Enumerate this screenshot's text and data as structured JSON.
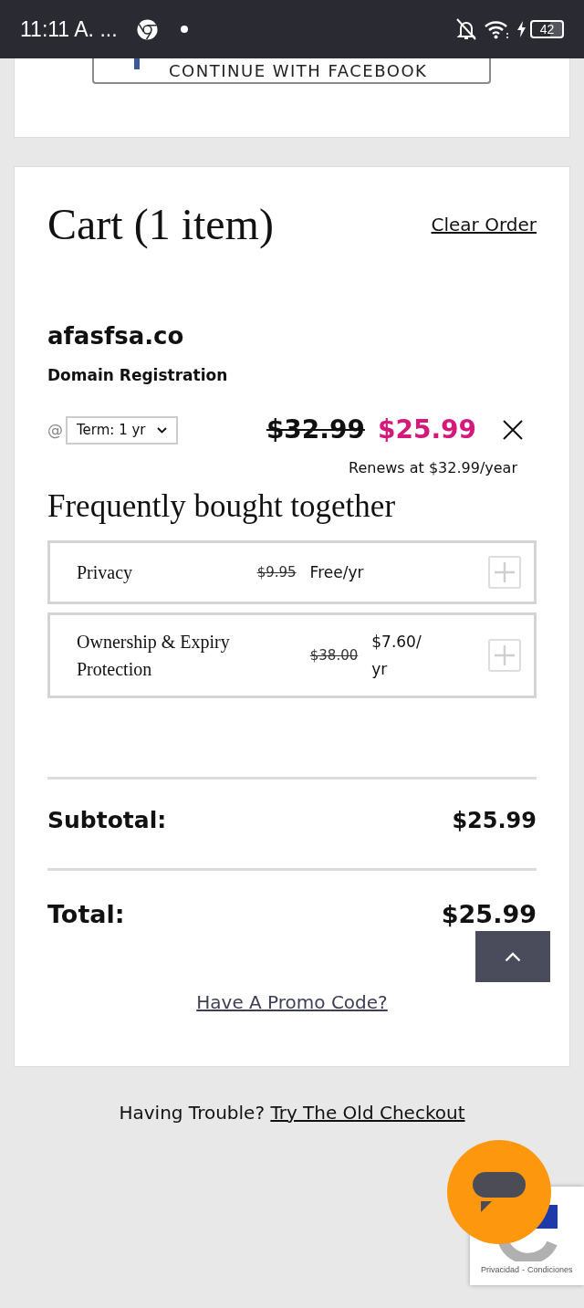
{
  "status_bar": {
    "time": "11:11 A. ...",
    "battery": "42"
  },
  "login_card": {
    "facebook_button": "CONTINUE WITH FACEBOOK"
  },
  "cart": {
    "title": "Cart (1 item)",
    "clear_link": "Clear Order",
    "items": [
      {
        "domain": "afasfsa.co",
        "type": "Domain Registration",
        "at_symbol": "@",
        "term": "Term: 1 yr",
        "old_price": "$32.99",
        "price": "$25.99",
        "renewal": "Renews at $32.99/year"
      }
    ],
    "addons_title": "Frequently bought together",
    "addons": [
      {
        "name": "Privacy",
        "old_price": "$9.95",
        "price": "Free/yr"
      },
      {
        "name": "Ownership & Expiry Protection",
        "old_price": "$38.00",
        "price": "$7.60/yr"
      }
    ],
    "subtotal": {
      "label": "Subtotal:",
      "value": "$25.99"
    },
    "total": {
      "label": "Total:",
      "value": "$25.99"
    },
    "promo_link": "Have A Promo Code?"
  },
  "footer": {
    "text": "Having Trouble?",
    "link": "Try The Old Checkout"
  },
  "recaptcha": {
    "privacy_link": "Privacidad",
    "separator": "-",
    "terms_link": "Condiciones"
  }
}
